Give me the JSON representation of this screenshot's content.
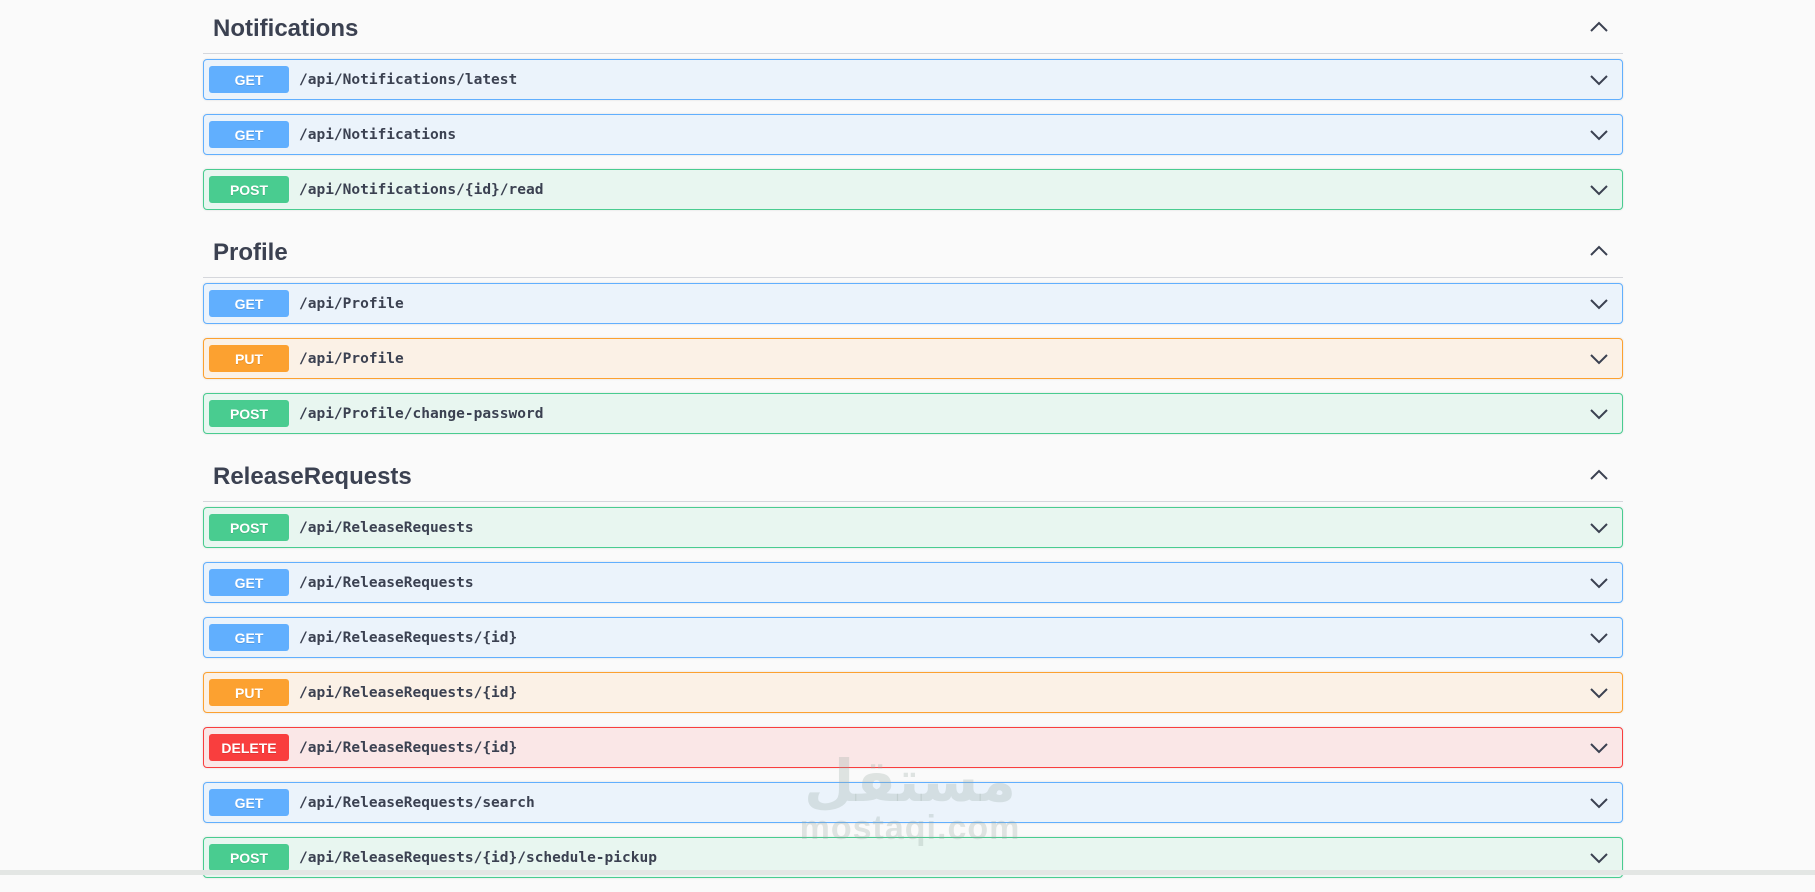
{
  "sections": [
    {
      "title": "Notifications",
      "operations": [
        {
          "method": "GET",
          "path": "/api/Notifications/latest"
        },
        {
          "method": "GET",
          "path": "/api/Notifications"
        },
        {
          "method": "POST",
          "path": "/api/Notifications/{id}/read"
        }
      ]
    },
    {
      "title": "Profile",
      "operations": [
        {
          "method": "GET",
          "path": "/api/Profile"
        },
        {
          "method": "PUT",
          "path": "/api/Profile"
        },
        {
          "method": "POST",
          "path": "/api/Profile/change-password"
        }
      ]
    },
    {
      "title": "ReleaseRequests",
      "operations": [
        {
          "method": "POST",
          "path": "/api/ReleaseRequests"
        },
        {
          "method": "GET",
          "path": "/api/ReleaseRequests"
        },
        {
          "method": "GET",
          "path": "/api/ReleaseRequests/{id}"
        },
        {
          "method": "PUT",
          "path": "/api/ReleaseRequests/{id}"
        },
        {
          "method": "DELETE",
          "path": "/api/ReleaseRequests/{id}"
        },
        {
          "method": "GET",
          "path": "/api/ReleaseRequests/search"
        },
        {
          "method": "POST",
          "path": "/api/ReleaseRequests/{id}/schedule-pickup"
        }
      ]
    }
  ],
  "icons": {
    "section_toggle": "chevron-up-icon",
    "operation_toggle": "chevron-down-icon"
  },
  "colors": {
    "GET": "#61affe",
    "POST": "#49cc90",
    "PUT": "#fca130",
    "DELETE": "#f93e3e"
  },
  "watermark": {
    "arabic": "مستقل",
    "latin": "mostaqi.com"
  }
}
